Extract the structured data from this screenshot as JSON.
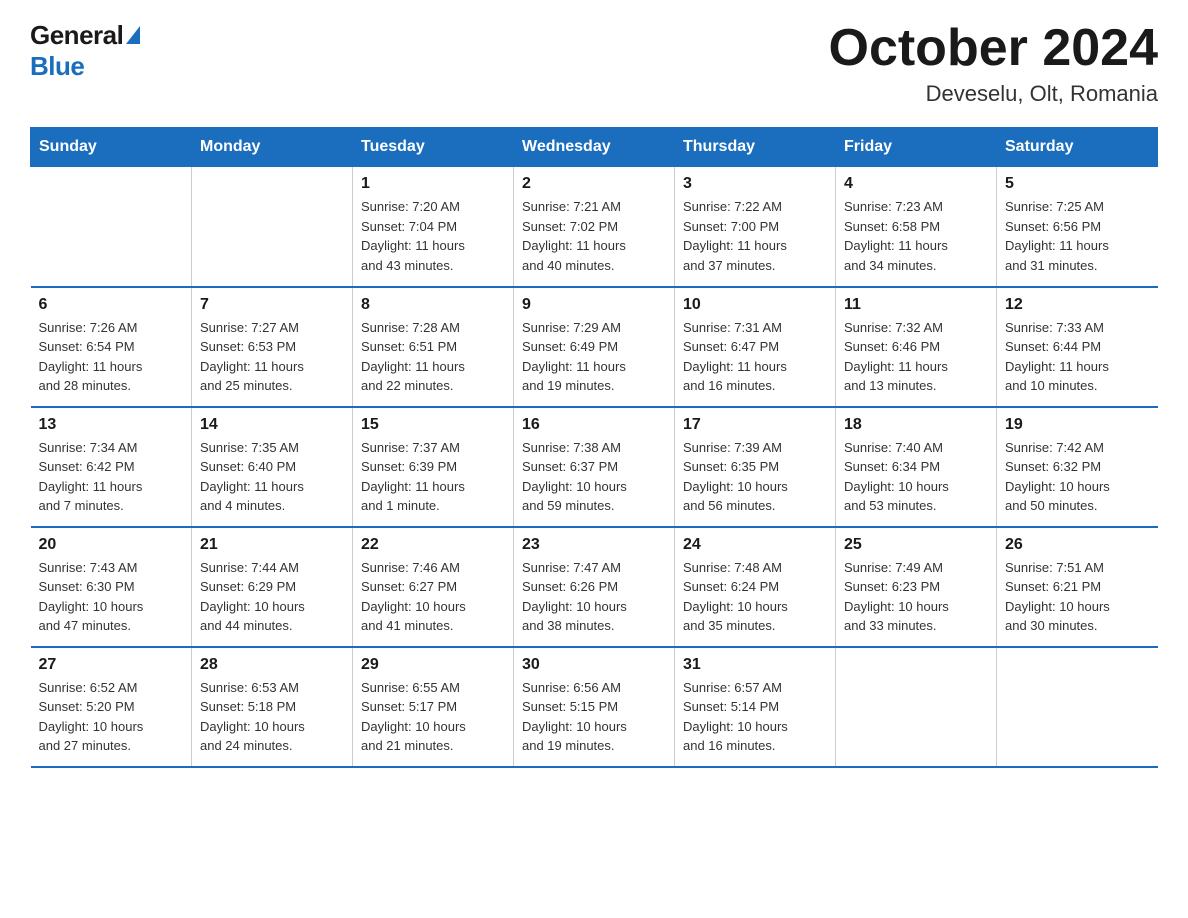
{
  "logo": {
    "general": "General",
    "blue": "Blue"
  },
  "title": "October 2024",
  "location": "Deveselu, Olt, Romania",
  "days_of_week": [
    "Sunday",
    "Monday",
    "Tuesday",
    "Wednesday",
    "Thursday",
    "Friday",
    "Saturday"
  ],
  "weeks": [
    [
      {
        "day": "",
        "info": ""
      },
      {
        "day": "",
        "info": ""
      },
      {
        "day": "1",
        "info": "Sunrise: 7:20 AM\nSunset: 7:04 PM\nDaylight: 11 hours\nand 43 minutes."
      },
      {
        "day": "2",
        "info": "Sunrise: 7:21 AM\nSunset: 7:02 PM\nDaylight: 11 hours\nand 40 minutes."
      },
      {
        "day": "3",
        "info": "Sunrise: 7:22 AM\nSunset: 7:00 PM\nDaylight: 11 hours\nand 37 minutes."
      },
      {
        "day": "4",
        "info": "Sunrise: 7:23 AM\nSunset: 6:58 PM\nDaylight: 11 hours\nand 34 minutes."
      },
      {
        "day": "5",
        "info": "Sunrise: 7:25 AM\nSunset: 6:56 PM\nDaylight: 11 hours\nand 31 minutes."
      }
    ],
    [
      {
        "day": "6",
        "info": "Sunrise: 7:26 AM\nSunset: 6:54 PM\nDaylight: 11 hours\nand 28 minutes."
      },
      {
        "day": "7",
        "info": "Sunrise: 7:27 AM\nSunset: 6:53 PM\nDaylight: 11 hours\nand 25 minutes."
      },
      {
        "day": "8",
        "info": "Sunrise: 7:28 AM\nSunset: 6:51 PM\nDaylight: 11 hours\nand 22 minutes."
      },
      {
        "day": "9",
        "info": "Sunrise: 7:29 AM\nSunset: 6:49 PM\nDaylight: 11 hours\nand 19 minutes."
      },
      {
        "day": "10",
        "info": "Sunrise: 7:31 AM\nSunset: 6:47 PM\nDaylight: 11 hours\nand 16 minutes."
      },
      {
        "day": "11",
        "info": "Sunrise: 7:32 AM\nSunset: 6:46 PM\nDaylight: 11 hours\nand 13 minutes."
      },
      {
        "day": "12",
        "info": "Sunrise: 7:33 AM\nSunset: 6:44 PM\nDaylight: 11 hours\nand 10 minutes."
      }
    ],
    [
      {
        "day": "13",
        "info": "Sunrise: 7:34 AM\nSunset: 6:42 PM\nDaylight: 11 hours\nand 7 minutes."
      },
      {
        "day": "14",
        "info": "Sunrise: 7:35 AM\nSunset: 6:40 PM\nDaylight: 11 hours\nand 4 minutes."
      },
      {
        "day": "15",
        "info": "Sunrise: 7:37 AM\nSunset: 6:39 PM\nDaylight: 11 hours\nand 1 minute."
      },
      {
        "day": "16",
        "info": "Sunrise: 7:38 AM\nSunset: 6:37 PM\nDaylight: 10 hours\nand 59 minutes."
      },
      {
        "day": "17",
        "info": "Sunrise: 7:39 AM\nSunset: 6:35 PM\nDaylight: 10 hours\nand 56 minutes."
      },
      {
        "day": "18",
        "info": "Sunrise: 7:40 AM\nSunset: 6:34 PM\nDaylight: 10 hours\nand 53 minutes."
      },
      {
        "day": "19",
        "info": "Sunrise: 7:42 AM\nSunset: 6:32 PM\nDaylight: 10 hours\nand 50 minutes."
      }
    ],
    [
      {
        "day": "20",
        "info": "Sunrise: 7:43 AM\nSunset: 6:30 PM\nDaylight: 10 hours\nand 47 minutes."
      },
      {
        "day": "21",
        "info": "Sunrise: 7:44 AM\nSunset: 6:29 PM\nDaylight: 10 hours\nand 44 minutes."
      },
      {
        "day": "22",
        "info": "Sunrise: 7:46 AM\nSunset: 6:27 PM\nDaylight: 10 hours\nand 41 minutes."
      },
      {
        "day": "23",
        "info": "Sunrise: 7:47 AM\nSunset: 6:26 PM\nDaylight: 10 hours\nand 38 minutes."
      },
      {
        "day": "24",
        "info": "Sunrise: 7:48 AM\nSunset: 6:24 PM\nDaylight: 10 hours\nand 35 minutes."
      },
      {
        "day": "25",
        "info": "Sunrise: 7:49 AM\nSunset: 6:23 PM\nDaylight: 10 hours\nand 33 minutes."
      },
      {
        "day": "26",
        "info": "Sunrise: 7:51 AM\nSunset: 6:21 PM\nDaylight: 10 hours\nand 30 minutes."
      }
    ],
    [
      {
        "day": "27",
        "info": "Sunrise: 6:52 AM\nSunset: 5:20 PM\nDaylight: 10 hours\nand 27 minutes."
      },
      {
        "day": "28",
        "info": "Sunrise: 6:53 AM\nSunset: 5:18 PM\nDaylight: 10 hours\nand 24 minutes."
      },
      {
        "day": "29",
        "info": "Sunrise: 6:55 AM\nSunset: 5:17 PM\nDaylight: 10 hours\nand 21 minutes."
      },
      {
        "day": "30",
        "info": "Sunrise: 6:56 AM\nSunset: 5:15 PM\nDaylight: 10 hours\nand 19 minutes."
      },
      {
        "day": "31",
        "info": "Sunrise: 6:57 AM\nSunset: 5:14 PM\nDaylight: 10 hours\nand 16 minutes."
      },
      {
        "day": "",
        "info": ""
      },
      {
        "day": "",
        "info": ""
      }
    ]
  ]
}
